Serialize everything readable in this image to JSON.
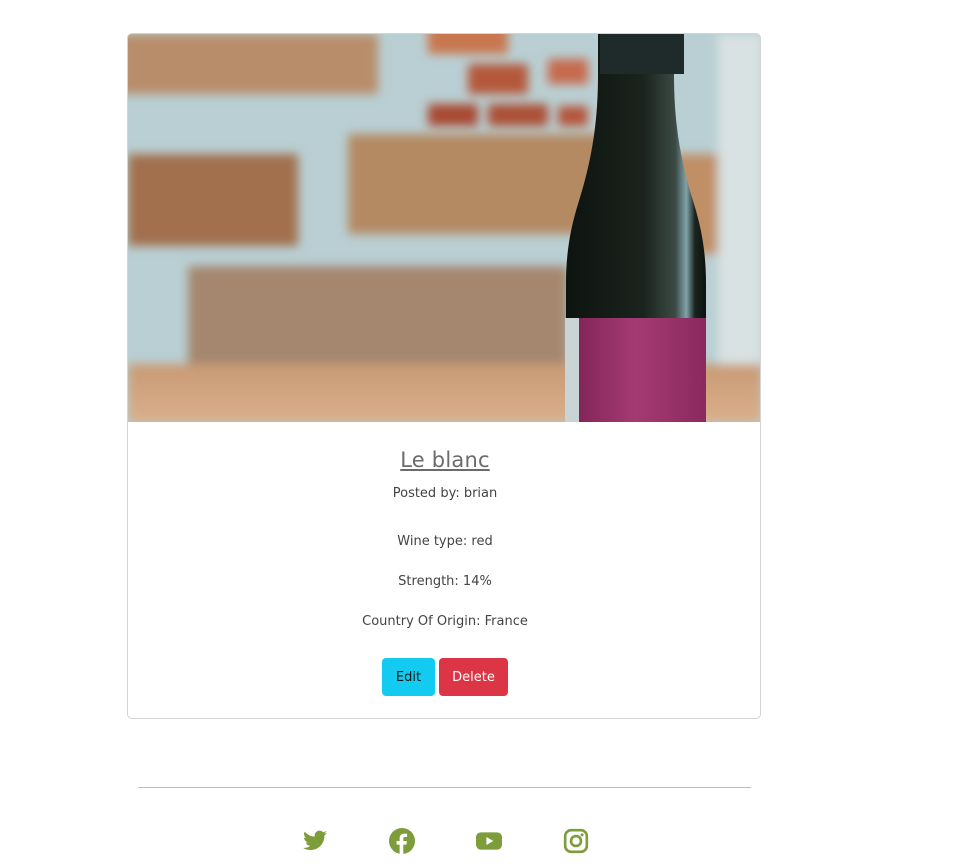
{
  "card": {
    "image_alt": "Wine bottle with magenta label in front of a brick wall",
    "title": "Le blanc",
    "posted_by": "Posted by: brian",
    "wine_type": "Wine type: red",
    "strength": "Strength: 14%",
    "country": "Country Of Origin: France",
    "edit_label": "Edit",
    "delete_label": "Delete"
  },
  "footer": {
    "social_icons": [
      "twitter-icon",
      "facebook-icon",
      "youtube-icon",
      "instagram-icon"
    ],
    "icon_color": "#7d9c3a"
  },
  "colors": {
    "edit_button": "#13caf0",
    "delete_button": "#dc3545",
    "title": "#6b6b6b",
    "card_border": "#d4d4d4"
  }
}
